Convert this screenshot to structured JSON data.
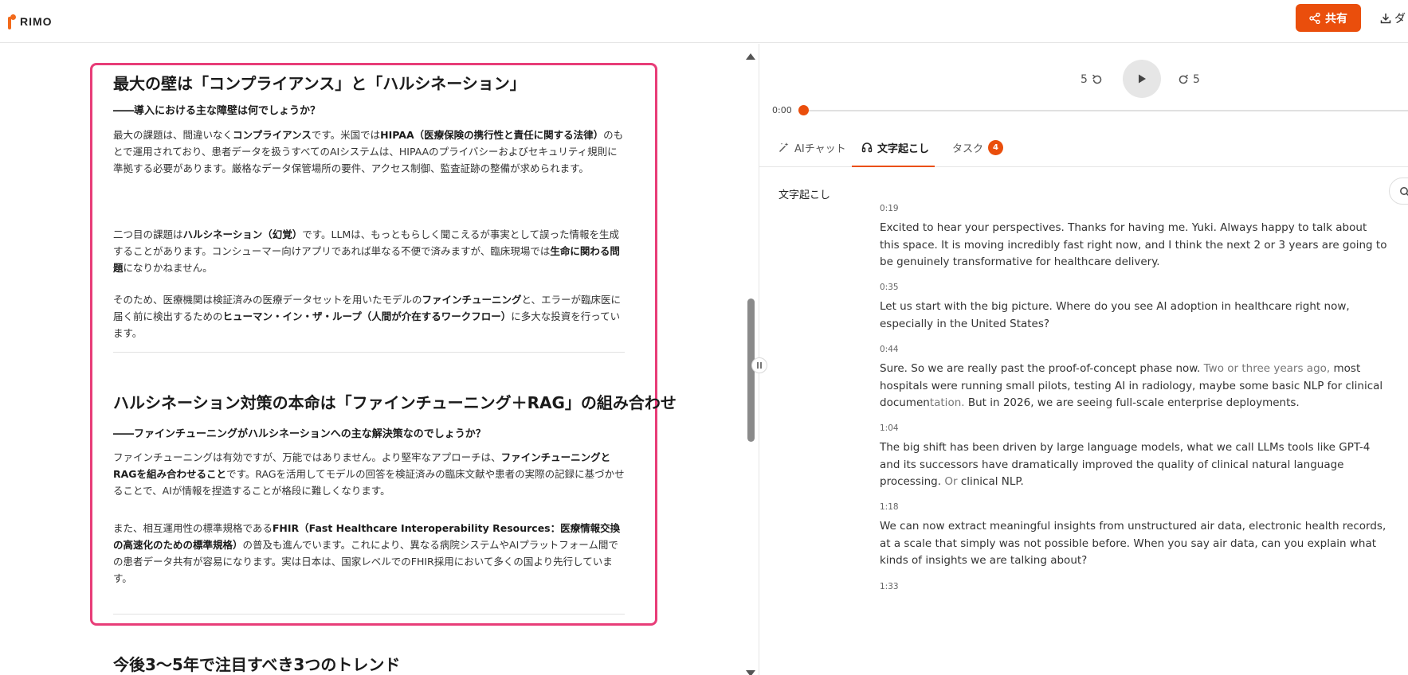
{
  "header": {
    "logo_text": "RIMO",
    "share_label": "共有",
    "download_label": "ダ"
  },
  "article": {
    "section1": {
      "title": "最大の壁は「コンプライアンス」と「ハルシネーション」",
      "subtitle": "――導入における主な障壁は何でしょうか？",
      "p1": [
        "最大の課題は、間違いなく",
        "コンプライアンス",
        "です。米国では",
        "HIPAA（医療保険の携行性と責任に関する法律）",
        "のもとで運用されており、患者データを扱うすべてのAIシステムは、HIPAAのプライバシーおよびセキュリティ規則に準拠する必要があります。厳格なデータ保管場所の要件、アクセス制御、監査証跡の整備が求められます。"
      ],
      "p2": [
        "二つ目の課題は",
        "ハルシネーション（幻覚）",
        "です。LLMは、もっともらしく聞こえるが事実として誤った情報を生成することがあります。コンシューマー向けアプリであれば単なる不便で済みますが、臨床現場では",
        "生命に関わる問題",
        "になりかねません。"
      ],
      "p3": [
        "そのため、医療機関は検証済みの医療データセットを用いたモデルの",
        "ファインチューニング",
        "と、エラーが臨床医に届く前に検出するための",
        "ヒューマン・イン・ザ・ループ（人間が介在するワークフロー）",
        "に多大な投資を行っています。"
      ]
    },
    "section2": {
      "title": "ハルシネーション対策の本命は「ファインチューニング＋RAG」の組み合わせ",
      "subtitle": "――ファインチューニングがハルシネーションへの主な解決策なのでしょうか？",
      "p1": [
        "ファインチューニングは有効ですが、万能ではありません。より堅牢なアプローチは、",
        "ファインチューニングとRAGを組み合わせること",
        "です。RAGを活用してモデルの回答を検証済みの臨床文献や患者の実際の記録に基づかせることで、AIが情報を捏造することが格段に難しくなります。"
      ],
      "p2": [
        "また、相互運用性の標準規格である",
        "FHIR（Fast Healthcare Interoperability Resources：医療情報交換の高速化のための標準規格）",
        "の普及も進んでいます。これにより、異なる病院システムやAIプラットフォーム間での患者データ共有が容易になります。実は日本は、国家レベルでのFHIR採用において多くの国より先行しています。"
      ]
    },
    "section3": {
      "title": "今後3〜5年で注目すべき3つのトレンド"
    }
  },
  "player": {
    "skip_back": "5",
    "skip_forward": "5",
    "current_time": "0:00",
    "progress": 0
  },
  "tabs": {
    "ai_chat": "AIチャット",
    "transcript": "文字起こし",
    "task": "タスク",
    "task_count": "4"
  },
  "transcript": {
    "label": "文字起こし",
    "segments": [
      {
        "time": "0:19",
        "text": "Excited to hear your perspectives. Thanks for having me. Yuki. Always happy to talk about this space. It is moving incredibly fast right now, and I think the next 2 or 3 years are going to be genuinely transformative for healthcare delivery."
      },
      {
        "time": "0:35",
        "text": " Let us start with the big picture. Where do you see AI adoption in healthcare right now, especially in the United States?"
      },
      {
        "time": "0:44",
        "text_a": " Sure. So we are really past the proof-of-concept phase now. ",
        "text_b": "Two or three years ago,",
        "text_c": " most hospitals were running small pilots, testing AI in radiology, maybe some basic NLP for clinical documen",
        "text_d": "tation.",
        "text_e": " But in 2026, we are seeing full-scale enterprise deployments."
      },
      {
        "time": "1:04",
        "text_a": " The big shift has been driven by large language models, what we call LLMs tools like GPT-4 and its successors have dramatically improved the quality of clinical natural language processing. ",
        "text_b": "Or",
        "text_c": " clinical NLP."
      },
      {
        "time": "1:18",
        "text": " We can now extract meaningful insights from unstructured air data, electronic health records, at a scale that simply was not possible before. When you say air data, can you explain what kinds of insights we are talking about?"
      },
      {
        "time": "1:33",
        "text": ""
      }
    ]
  }
}
